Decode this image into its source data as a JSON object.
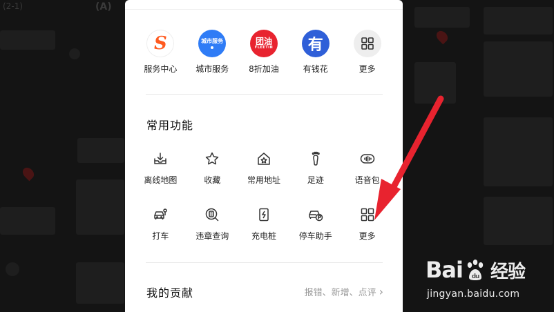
{
  "background": {
    "title_left": "(2-1)",
    "title_right": "(A)"
  },
  "top_apps": [
    {
      "label": "服务中心",
      "icon": "fuwu-s-icon",
      "icon_text": "S"
    },
    {
      "label": "城市服务",
      "icon": "city-service-icon",
      "icon_text": "城市服务"
    },
    {
      "label": "8折加油",
      "icon": "fuel-icon",
      "icon_text": "团油",
      "icon_sub": "FLEETIN"
    },
    {
      "label": "有钱花",
      "icon": "youqianhua-icon",
      "icon_text": "有"
    },
    {
      "label": "更多",
      "icon": "grid-icon"
    }
  ],
  "common": {
    "title": "常用功能",
    "row1": [
      {
        "label": "离线地图",
        "icon": "download-tray-icon"
      },
      {
        "label": "收藏",
        "icon": "star-icon"
      },
      {
        "label": "常用地址",
        "icon": "home-star-icon"
      },
      {
        "label": "足迹",
        "icon": "footprint-icon"
      },
      {
        "label": "语音包",
        "icon": "voice-wave-icon"
      }
    ],
    "row2": [
      {
        "label": "打车",
        "icon": "taxi-icon"
      },
      {
        "label": "违章查询",
        "icon": "violation-query-icon"
      },
      {
        "label": "充电桩",
        "icon": "charging-pile-icon"
      },
      {
        "label": "停车助手",
        "icon": "parking-assistant-icon"
      },
      {
        "label": "更多",
        "icon": "grid-icon"
      }
    ]
  },
  "contribution": {
    "title": "我的贡献",
    "link": "报错、新增、点评"
  },
  "watermark": {
    "brand_left": "Bai",
    "brand_right": "du",
    "brand_cn": "经验",
    "url": "jingyan.baidu.com"
  },
  "colors": {
    "arrow": "#e8232f",
    "fuwu": "#ff5a1f",
    "city": "#2f7cf6",
    "oil": "#e8232f",
    "youqianhua": "#2f5fd8"
  }
}
